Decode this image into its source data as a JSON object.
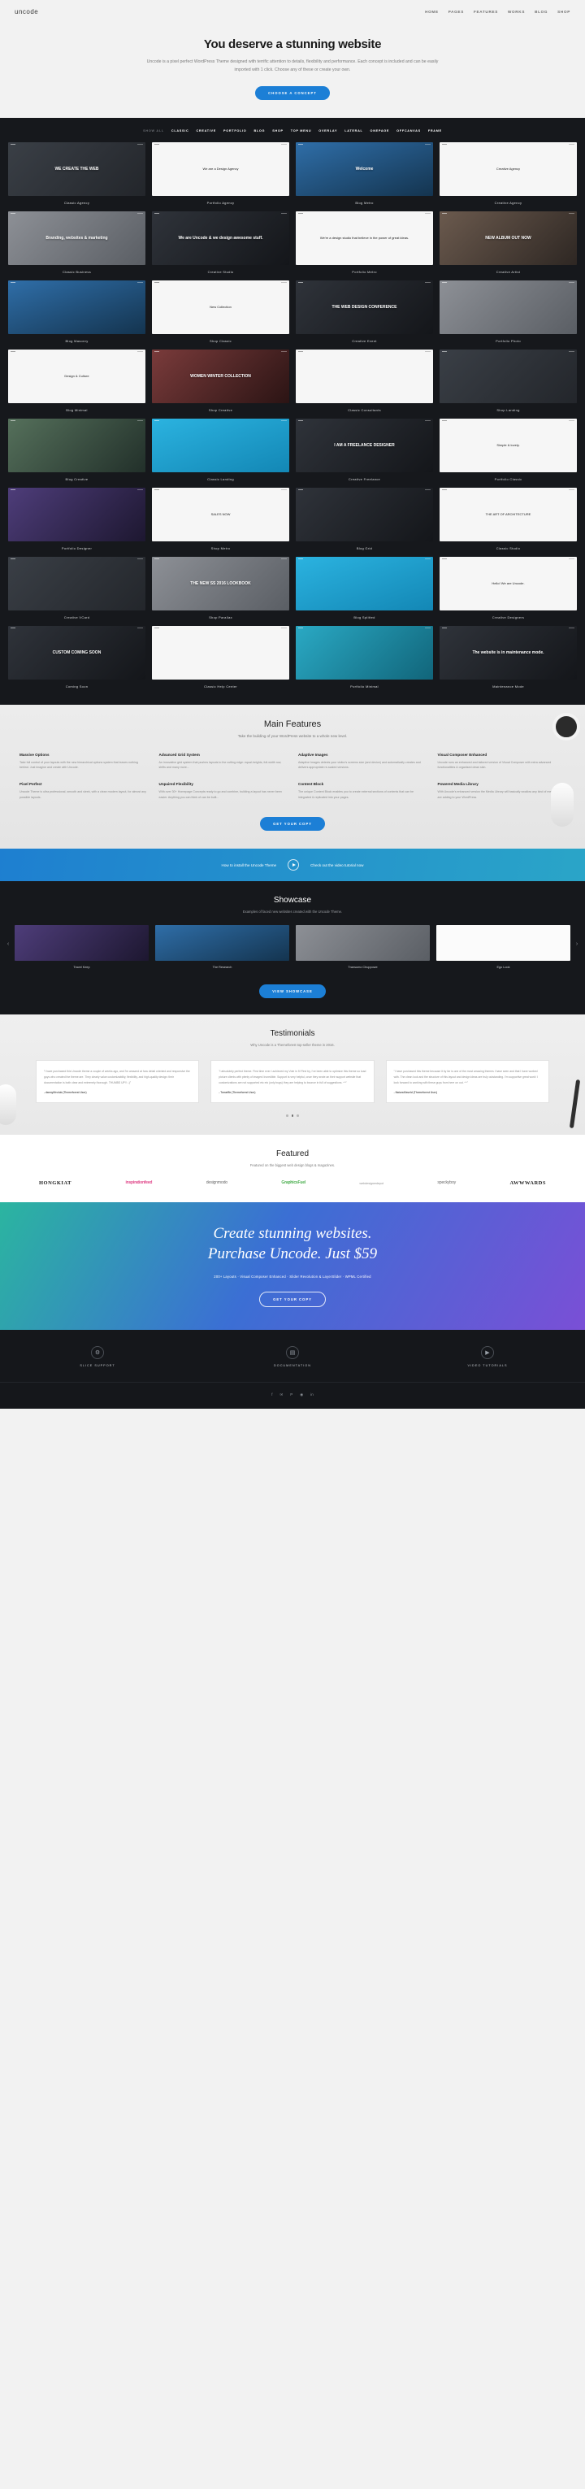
{
  "header": {
    "logo": "uncode",
    "nav": [
      "HOME",
      "PAGES",
      "FEATURES",
      "WORKS",
      "BLOG",
      "SHOP"
    ]
  },
  "hero": {
    "title": "You deserve a stunning website",
    "paragraph": "Uncode is a pixel perfect WordPress Theme designed with terrific attention to details, flexibility and performance. Each concept is included and can be easily imported with 1 click. Choose any of these or create your own.",
    "cta": "CHOOSE A CONCEPT"
  },
  "concepts": {
    "filters": [
      {
        "label": "SHOW ALL",
        "active": false
      },
      {
        "label": "CLASSIC",
        "active": true
      },
      {
        "label": "CREATIVE",
        "active": true
      },
      {
        "label": "PORTFOLIO",
        "active": true
      },
      {
        "label": "BLOG",
        "active": true
      },
      {
        "label": "SHOP",
        "active": true
      },
      {
        "label": "TOP MENU",
        "active": true
      },
      {
        "label": "OVERLAY",
        "active": true
      },
      {
        "label": "LATERAL",
        "active": true
      },
      {
        "label": "ONEPAGE",
        "active": true
      },
      {
        "label": "OFFCANVAS",
        "active": true
      },
      {
        "label": "FRAME",
        "active": true
      }
    ],
    "items": [
      {
        "caption": "Classic Agency",
        "overlay": "WE CREATE THE WEB",
        "style": "t-dark1",
        "light": false
      },
      {
        "caption": "Portfolio Agency",
        "overlay": "We are a Design Agency",
        "style": "t-white",
        "light": true
      },
      {
        "caption": "Blog Metro",
        "overlay": "Welcome",
        "style": "t-blue",
        "light": false
      },
      {
        "caption": "Creative Agency",
        "overlay": "Creative Agency",
        "style": "t-white",
        "light": true
      },
      {
        "caption": "Classic Business",
        "overlay": "Branding, websites & marketing",
        "style": "t-gray",
        "light": false
      },
      {
        "caption": "Creative Studio",
        "overlay": "We are Uncode & we design awesome stuff.",
        "style": "t-dark2",
        "light": false
      },
      {
        "caption": "Portfolio Metro",
        "overlay": "We're a design studio that believe in the power of great ideas.",
        "style": "t-white",
        "light": true
      },
      {
        "caption": "Creative Artist",
        "overlay": "NEW ALBUM OUT NOW",
        "style": "t-warm",
        "light": false
      },
      {
        "caption": "Blog Masonry",
        "overlay": "",
        "style": "t-blue",
        "light": false
      },
      {
        "caption": "Shop Classic",
        "overlay": "New Collection",
        "style": "t-white",
        "light": true
      },
      {
        "caption": "Creative Event",
        "overlay": "THE WEB DESIGN CONFERENCE",
        "style": "t-dark2",
        "light": false
      },
      {
        "caption": "Portfolio Photo",
        "overlay": "",
        "style": "t-gray",
        "light": false
      },
      {
        "caption": "Blog Minimal",
        "overlay": "Design & Culture",
        "style": "t-white",
        "light": true
      },
      {
        "caption": "Shop Creative",
        "overlay": "WOMEN WINTER COLLECTION",
        "style": "t-red",
        "light": false
      },
      {
        "caption": "Classic Consultants",
        "overlay": "",
        "style": "t-white",
        "light": true
      },
      {
        "caption": "Shop Landing",
        "overlay": "",
        "style": "t-dark1",
        "light": false
      },
      {
        "caption": "Blog Creative",
        "overlay": "",
        "style": "t-green",
        "light": false
      },
      {
        "caption": "Classic Landing",
        "overlay": "",
        "style": "t-cyan",
        "light": false
      },
      {
        "caption": "Creative Freelance",
        "overlay": "I AM A FREELANCE DESIGNER",
        "style": "t-dark2",
        "light": false
      },
      {
        "caption": "Portfolio Classic",
        "overlay": "Simple & lovely.",
        "style": "t-white",
        "light": true
      },
      {
        "caption": "Portfolio Designer",
        "overlay": "",
        "style": "t-purple",
        "light": false
      },
      {
        "caption": "Shop Metro",
        "overlay": "SALES NOW",
        "style": "t-white",
        "light": true
      },
      {
        "caption": "Blog Grid",
        "overlay": "",
        "style": "t-dark2",
        "light": false
      },
      {
        "caption": "Classic Studio",
        "overlay": "THE ART OF ARCHITECTURE",
        "style": "t-white",
        "light": true
      },
      {
        "caption": "Creative VCard",
        "overlay": "",
        "style": "t-dark1",
        "light": false
      },
      {
        "caption": "Shop Parallax",
        "overlay": "THE NEW SS 2016 LOOKBOOK",
        "style": "t-gray",
        "light": false
      },
      {
        "caption": "Blog Splitted",
        "overlay": "",
        "style": "t-cyan",
        "light": false
      },
      {
        "caption": "Creative Designers",
        "overlay": "Hello! We are Uncode.",
        "style": "t-white",
        "light": true
      },
      {
        "caption": "Coming Soon",
        "overlay": "CUSTOM COMING SOON",
        "style": "t-dark2",
        "light": false
      },
      {
        "caption": "Classic Help Center",
        "overlay": "",
        "style": "t-white",
        "light": true
      },
      {
        "caption": "Portfolio Minimal",
        "overlay": "",
        "style": "t-teal",
        "light": false
      },
      {
        "caption": "Maintenance Mode",
        "overlay": "The website is in maintenance mode.",
        "style": "t-dark2",
        "light": false
      }
    ]
  },
  "features": {
    "title": "Main Features",
    "subtitle": "Take the building of your WordPress website to a whole new level.",
    "cta": "GET YOUR COPY",
    "items": [
      {
        "title": "Massive Options",
        "body": "Take full control of your layouts with the new hierarchical options system that leaves nothing behind. Just imagine and create with Uncode."
      },
      {
        "title": "Advanced Grid System",
        "body": "An innovative grid system that pushes layouts to the cutting edge: equal-heights, full-width row, shifts and many more..."
      },
      {
        "title": "Adaptive Images",
        "body": "Adaptive Images detects your visitor's screens size (and device) and automatically creates and delivers appropriate re-scaled versions."
      },
      {
        "title": "Visual Composer Enhanced",
        "body": "Uncode runs an enhanced and tailored version of Visual Composer with extra advanced functionalities & organised clean skin."
      },
      {
        "title": "Pixel Perfect",
        "body": "Uncode Theme is ultra professional, smooth and sleek, with a clean modern layout, for almost any possible layouts."
      },
      {
        "title": "Unpaired Flexibility",
        "body": "With over 30+ Homepage Concepts ready to go and combine, building a layout has never been easier. Anything you can think of can be built..."
      },
      {
        "title": "Content Block",
        "body": "The unique Content Block enables you to create external sections of contents that can be integrated & replicated into your pages."
      },
      {
        "title": "Powered Media Library",
        "body": "With Uncode's enhanced version the Media Library will basically swallow any kind of media you are adding to your WordPress."
      }
    ]
  },
  "video": {
    "left_text": "How to install the Uncode Theme",
    "right_text": "Check out the video tutorial now",
    "play_icon": "play-icon"
  },
  "showcase": {
    "title": "Showcase",
    "subtitle": "Examples of faced new websites created with the Uncode Theme.",
    "cta": "VIEW SHOWCASE",
    "items": [
      {
        "label": "Travel Keep",
        "style": "t-purple"
      },
      {
        "label": "The Research",
        "style": "t-blue"
      },
      {
        "label": "Transumo Chuppowe",
        "style": "t-gray"
      },
      {
        "label": "Ego Look",
        "style": "t-white"
      }
    ]
  },
  "testimonials": {
    "title": "Testimonials",
    "subtitle": "Why Uncode is a Themeforest top-seller theme in 2016.",
    "items": [
      {
        "quote": "\"I have purchased this Uncode theme a couple of weeks ago, and I'm amazed at how detail oriented and responsive the guys who created the theme are. They clearly value customizability, flexibility, and high-quality design: their documentation is both clear and extremely thorough. THUMBS UP!! :-)\"",
        "author": "- dannylifeclub (Themeforest User)"
      },
      {
        "quote": "\"I absolutely perfect theme. First time ever I achieved my Vote in 5! First try, I've been able to optimize this theme so load picture clients with plenty of images! Incredible. Support is very helpful, once they wrote an their support website that customizations are not supported etc etc (only bugs) they are helping to bounce in full of suggestions. ^^\"",
        "author": "- Tomaffle (Themeforest User)"
      },
      {
        "quote": "\"I have purchased this theme because it by far is one of the most amazing themes I have seen and that I have worked with. The clean look and the structure of this layout and design ideas are truly outstanding. I'm supportive great work! I look forward to working with these guys from here on out. ^^\"",
        "author": "- NaturalXaveld (Themeforest User)"
      }
    ],
    "dots": 3,
    "active_dot": 1
  },
  "featured": {
    "title": "Featured",
    "subtitle": "Featured on the biggest web design blogs & magazines.",
    "logos": [
      {
        "text": "HONGKIAT",
        "style": "lg-serif"
      },
      {
        "text": "inspirationfeed",
        "style": "lg-pink"
      },
      {
        "text": "designmodo",
        "style": "lg-gray"
      },
      {
        "text": "GraphicsFuel",
        "style": "lg-grn"
      },
      {
        "text": "webdesignerdepot",
        "style": "lg-sm"
      },
      {
        "text": "speckyboy",
        "style": "lg-gray"
      },
      {
        "text": "AWWWARDS",
        "style": "lg-serif"
      }
    ]
  },
  "purchase": {
    "line1": "Create stunning websites.",
    "line2": "Purchase Uncode. Just $59",
    "meta": "200+ Layouts · Visual Composer Enhanced · Slider Revolution & LayerSlider · WPML Certified",
    "cta": "GET YOUR COPY"
  },
  "footer": {
    "columns": [
      {
        "label": "SLICE SUPPORT",
        "icon": "lifebuoy-icon",
        "glyph": "⚙"
      },
      {
        "label": "DOCUMENTATION",
        "icon": "book-icon",
        "glyph": "▤"
      },
      {
        "label": "VIDEO TUTORIALS",
        "icon": "video-icon",
        "glyph": "▶"
      }
    ],
    "social": [
      "f",
      "✉",
      "P",
      "◉",
      "in"
    ]
  },
  "colors": {
    "accent": "#1c7fd6",
    "dark": "#16181c",
    "light": "#f2f2f2"
  }
}
